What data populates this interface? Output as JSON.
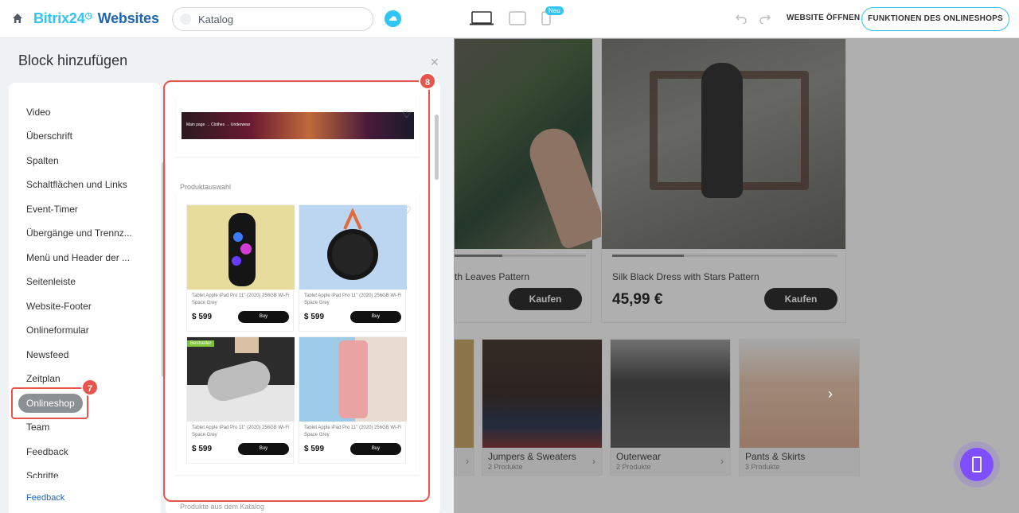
{
  "header": {
    "brand_part1": "Bitrix24",
    "brand_part2": "Websites",
    "search_value": "Katalog",
    "new_badge": "Neu",
    "open_website": "WEBSITE ÖFFNEN",
    "shop_functions": "FUNKTIONEN DES ONLINESHOPS"
  },
  "panel": {
    "title": "Block hinzufügen",
    "categories": [
      "Video",
      "Überschrift",
      "Spalten",
      "Schaltflächen und Links",
      "Event-Timer",
      "Übergänge und Trennz...",
      "Menü und Header der ...",
      "Seitenleiste",
      "Website-Footer",
      "Onlineformular",
      "Newsfeed",
      "Zeitplan",
      "Onlineshop",
      "Team",
      "Feedback",
      "Schritte"
    ],
    "active_category": "Onlineshop",
    "feedback_link": "Feedback"
  },
  "preview": {
    "banner_breadcrumb": "Main page  →  Clothes  →  Underwear",
    "section_label": "Produktauswahl",
    "next_section_label": "Produkte aus dem Katalog",
    "products": [
      {
        "title": "Tablet Apple iPad Pro 11\" (2020)  256GB Wi-Fi Space Grey",
        "price": "$ 599",
        "buy": "Buy",
        "badge": ""
      },
      {
        "title": "Tablet Apple iPad Pro 11\" (2020)  256GB Wi-Fi Space Grey",
        "price": "$ 599",
        "buy": "Buy",
        "badge": ""
      },
      {
        "title": "Tablet Apple iPad Pro 11\" (2020)  256GB Wi-Fi Space Grey",
        "price": "$ 599",
        "buy": "Buy",
        "badge": "Bestseller"
      },
      {
        "title": "Tablet Apple iPad Pro 11\" (2020)  256GB Wi-Fi Space Grey",
        "price": "$ 599",
        "buy": "Buy",
        "badge": ""
      }
    ]
  },
  "store": {
    "product1_name": "th Leaves Pattern",
    "product1_buy": "Kaufen",
    "product2_name": "Silk Black Dress with Stars Pattern",
    "product2_price": "45,99 €",
    "product2_buy": "Kaufen",
    "categories": [
      {
        "name": "Jumpers & Sweaters",
        "count": "2 Produkte"
      },
      {
        "name": "Outerwear",
        "count": "2 Produkte"
      },
      {
        "name": "Pants & Skirts",
        "count": "3 Produkte"
      }
    ]
  },
  "annotations": {
    "step7": "7",
    "step8": "8"
  },
  "colors": {
    "accent": "#2fc6f6",
    "brand_dark": "#2066b0",
    "highlight": "#e8554e",
    "fab": "#7e4fff"
  }
}
